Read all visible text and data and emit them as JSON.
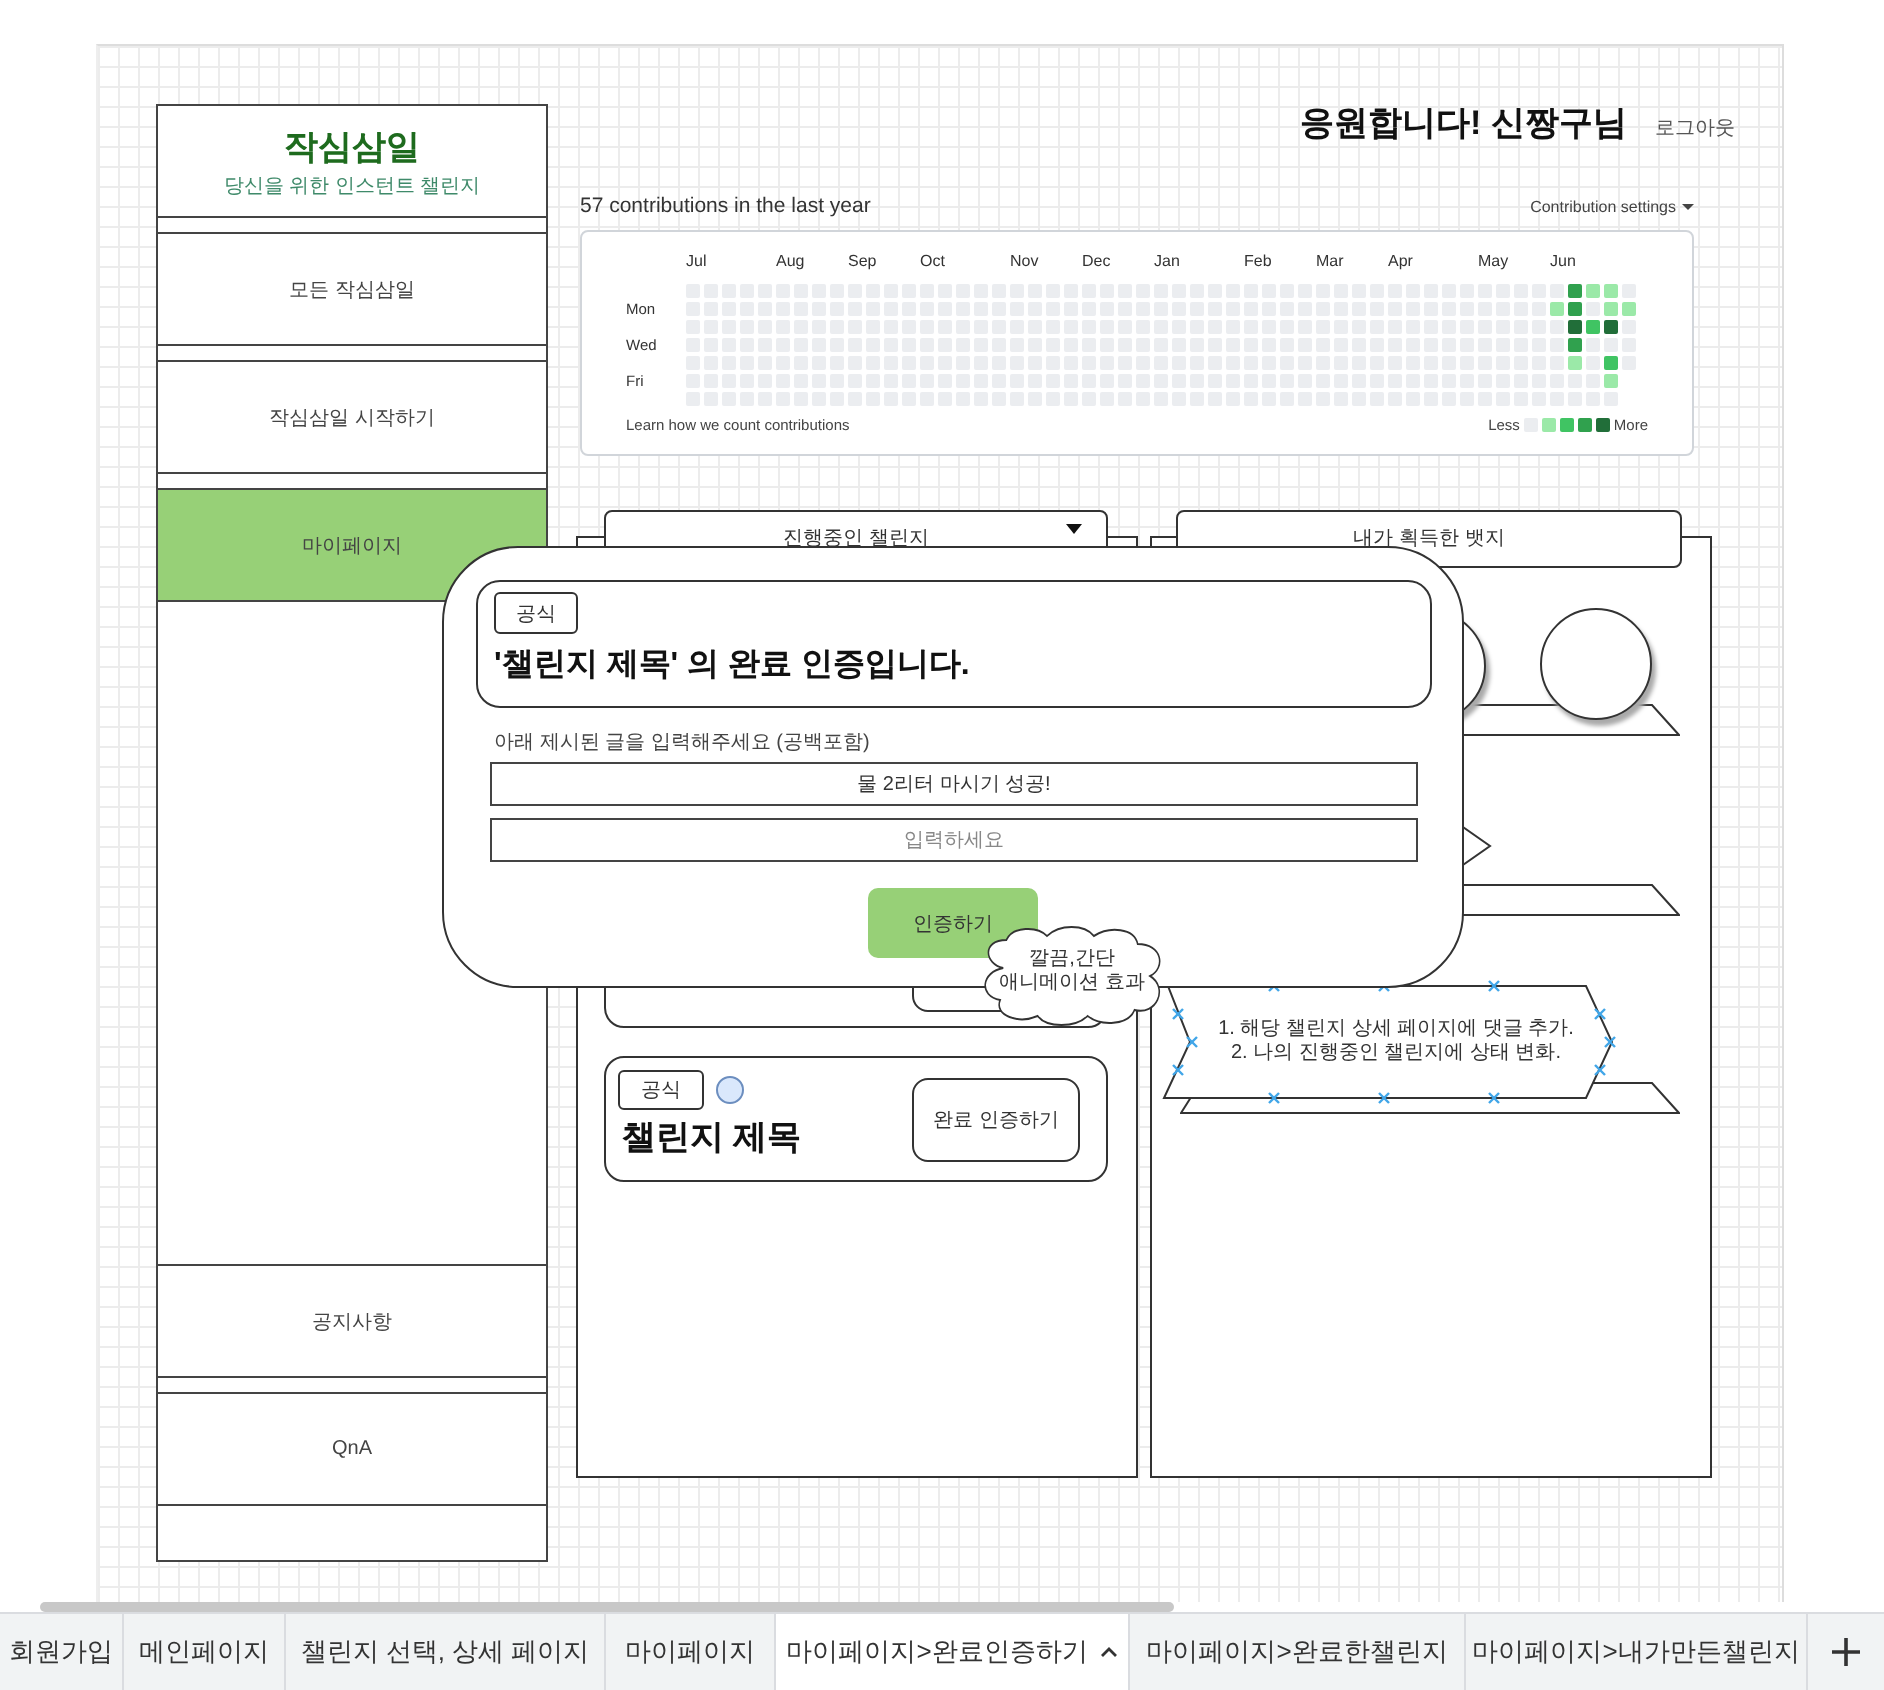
{
  "header": {
    "greeting": "응원합니다! 신짱구님",
    "logout": "로그아웃"
  },
  "sidebar": {
    "logo": "작심삼일",
    "tagline": "당신을 위한 인스턴트 챌린지",
    "items": [
      {
        "label": "모든 작심삼일",
        "selected": false
      },
      {
        "label": "작심삼일 시작하기",
        "selected": false
      },
      {
        "label": "마이페이지",
        "selected": true
      }
    ],
    "footer_items": [
      {
        "label": "공지사항",
        "selected": false
      },
      {
        "label": "QnA",
        "selected": false
      }
    ]
  },
  "contributions": {
    "title": "57 contributions in the last year",
    "settings": "Contribution settings",
    "months": [
      "Jul",
      "Aug",
      "Sep",
      "Oct",
      "Nov",
      "Dec",
      "Jan",
      "Feb",
      "Mar",
      "Apr",
      "May",
      "Jun"
    ],
    "rows": [
      {
        "day": "",
        "cells": [
          {
            "color": "#ebedf0"
          },
          {
            "color": "#ebedf0"
          },
          {
            "color": "#ebedf0"
          },
          {
            "color": "#ebedf0"
          },
          {
            "color": "#ebedf0"
          },
          {
            "color": "#ebedf0"
          },
          {
            "color": "#ebedf0"
          },
          {
            "color": "#ebedf0"
          },
          {
            "color": "#ebedf0"
          },
          {
            "color": "#ebedf0"
          },
          {
            "color": "#ebedf0"
          },
          {
            "color": "#ebedf0"
          },
          {
            "color": "#ebedf0"
          },
          {
            "color": "#ebedf0"
          },
          {
            "color": "#ebedf0"
          },
          {
            "color": "#ebedf0"
          },
          {
            "color": "#ebedf0"
          },
          {
            "color": "#ebedf0"
          },
          {
            "color": "#ebedf0"
          },
          {
            "color": "#ebedf0"
          },
          {
            "color": "#ebedf0"
          },
          {
            "color": "#ebedf0"
          },
          {
            "color": "#ebedf0"
          },
          {
            "color": "#ebedf0"
          },
          {
            "color": "#ebedf0"
          },
          {
            "color": "#ebedf0"
          },
          {
            "color": "#ebedf0"
          },
          {
            "color": "#ebedf0"
          },
          {
            "color": "#ebedf0"
          },
          {
            "color": "#ebedf0"
          },
          {
            "color": "#ebedf0"
          },
          {
            "color": "#ebedf0"
          },
          {
            "color": "#ebedf0"
          },
          {
            "color": "#ebedf0"
          },
          {
            "color": "#ebedf0"
          },
          {
            "color": "#ebedf0"
          },
          {
            "color": "#ebedf0"
          },
          {
            "color": "#ebedf0"
          },
          {
            "color": "#ebedf0"
          },
          {
            "color": "#ebedf0"
          },
          {
            "color": "#ebedf0"
          },
          {
            "color": "#ebedf0"
          },
          {
            "color": "#ebedf0"
          },
          {
            "color": "#ebedf0"
          },
          {
            "color": "#ebedf0"
          },
          {
            "color": "#ebedf0"
          },
          {
            "color": "#ebedf0"
          },
          {
            "color": "#ebedf0"
          },
          {
            "color": "#ebedf0"
          },
          {
            "color": "#30a14e"
          },
          {
            "color": "#9be9a8"
          },
          {
            "color": "#9be9a8"
          },
          {
            "color": "#ebedf0"
          }
        ]
      },
      {
        "day": "Mon",
        "cells": [
          {
            "color": "#ebedf0"
          },
          {
            "color": "#ebedf0"
          },
          {
            "color": "#ebedf0"
          },
          {
            "color": "#ebedf0"
          },
          {
            "color": "#ebedf0"
          },
          {
            "color": "#ebedf0"
          },
          {
            "color": "#ebedf0"
          },
          {
            "color": "#ebedf0"
          },
          {
            "color": "#ebedf0"
          },
          {
            "color": "#ebedf0"
          },
          {
            "color": "#ebedf0"
          },
          {
            "color": "#ebedf0"
          },
          {
            "color": "#ebedf0"
          },
          {
            "color": "#ebedf0"
          },
          {
            "color": "#ebedf0"
          },
          {
            "color": "#ebedf0"
          },
          {
            "color": "#ebedf0"
          },
          {
            "color": "#ebedf0"
          },
          {
            "color": "#ebedf0"
          },
          {
            "color": "#ebedf0"
          },
          {
            "color": "#ebedf0"
          },
          {
            "color": "#ebedf0"
          },
          {
            "color": "#ebedf0"
          },
          {
            "color": "#ebedf0"
          },
          {
            "color": "#ebedf0"
          },
          {
            "color": "#ebedf0"
          },
          {
            "color": "#ebedf0"
          },
          {
            "color": "#ebedf0"
          },
          {
            "color": "#ebedf0"
          },
          {
            "color": "#ebedf0"
          },
          {
            "color": "#ebedf0"
          },
          {
            "color": "#ebedf0"
          },
          {
            "color": "#ebedf0"
          },
          {
            "color": "#ebedf0"
          },
          {
            "color": "#ebedf0"
          },
          {
            "color": "#ebedf0"
          },
          {
            "color": "#ebedf0"
          },
          {
            "color": "#ebedf0"
          },
          {
            "color": "#ebedf0"
          },
          {
            "color": "#ebedf0"
          },
          {
            "color": "#ebedf0"
          },
          {
            "color": "#ebedf0"
          },
          {
            "color": "#ebedf0"
          },
          {
            "color": "#ebedf0"
          },
          {
            "color": "#ebedf0"
          },
          {
            "color": "#ebedf0"
          },
          {
            "color": "#ebedf0"
          },
          {
            "color": "#ebedf0"
          },
          {
            "color": "#9be9a8"
          },
          {
            "color": "#30a14e"
          },
          {
            "color": "#ebedf0"
          },
          {
            "color": "#9be9a8"
          },
          {
            "color": "#9be9a8"
          }
        ]
      },
      {
        "day": "",
        "cells": [
          {
            "color": "#ebedf0"
          },
          {
            "color": "#ebedf0"
          },
          {
            "color": "#ebedf0"
          },
          {
            "color": "#ebedf0"
          },
          {
            "color": "#ebedf0"
          },
          {
            "color": "#ebedf0"
          },
          {
            "color": "#ebedf0"
          },
          {
            "color": "#ebedf0"
          },
          {
            "color": "#ebedf0"
          },
          {
            "color": "#ebedf0"
          },
          {
            "color": "#ebedf0"
          },
          {
            "color": "#ebedf0"
          },
          {
            "color": "#ebedf0"
          },
          {
            "color": "#ebedf0"
          },
          {
            "color": "#ebedf0"
          },
          {
            "color": "#ebedf0"
          },
          {
            "color": "#ebedf0"
          },
          {
            "color": "#ebedf0"
          },
          {
            "color": "#ebedf0"
          },
          {
            "color": "#ebedf0"
          },
          {
            "color": "#ebedf0"
          },
          {
            "color": "#ebedf0"
          },
          {
            "color": "#ebedf0"
          },
          {
            "color": "#ebedf0"
          },
          {
            "color": "#ebedf0"
          },
          {
            "color": "#ebedf0"
          },
          {
            "color": "#ebedf0"
          },
          {
            "color": "#ebedf0"
          },
          {
            "color": "#ebedf0"
          },
          {
            "color": "#ebedf0"
          },
          {
            "color": "#ebedf0"
          },
          {
            "color": "#ebedf0"
          },
          {
            "color": "#ebedf0"
          },
          {
            "color": "#ebedf0"
          },
          {
            "color": "#ebedf0"
          },
          {
            "color": "#ebedf0"
          },
          {
            "color": "#ebedf0"
          },
          {
            "color": "#ebedf0"
          },
          {
            "color": "#ebedf0"
          },
          {
            "color": "#ebedf0"
          },
          {
            "color": "#ebedf0"
          },
          {
            "color": "#ebedf0"
          },
          {
            "color": "#ebedf0"
          },
          {
            "color": "#ebedf0"
          },
          {
            "color": "#ebedf0"
          },
          {
            "color": "#ebedf0"
          },
          {
            "color": "#ebedf0"
          },
          {
            "color": "#ebedf0"
          },
          {
            "color": "#ebedf0"
          },
          {
            "color": "#216e39"
          },
          {
            "color": "#40c463"
          },
          {
            "color": "#216e39"
          },
          {
            "color": "#ebedf0"
          }
        ]
      },
      {
        "day": "Wed",
        "cells": [
          {
            "color": "#ebedf0"
          },
          {
            "color": "#ebedf0"
          },
          {
            "color": "#ebedf0"
          },
          {
            "color": "#ebedf0"
          },
          {
            "color": "#ebedf0"
          },
          {
            "color": "#ebedf0"
          },
          {
            "color": "#ebedf0"
          },
          {
            "color": "#ebedf0"
          },
          {
            "color": "#ebedf0"
          },
          {
            "color": "#ebedf0"
          },
          {
            "color": "#ebedf0"
          },
          {
            "color": "#ebedf0"
          },
          {
            "color": "#ebedf0"
          },
          {
            "color": "#ebedf0"
          },
          {
            "color": "#ebedf0"
          },
          {
            "color": "#ebedf0"
          },
          {
            "color": "#ebedf0"
          },
          {
            "color": "#ebedf0"
          },
          {
            "color": "#ebedf0"
          },
          {
            "color": "#ebedf0"
          },
          {
            "color": "#ebedf0"
          },
          {
            "color": "#ebedf0"
          },
          {
            "color": "#ebedf0"
          },
          {
            "color": "#ebedf0"
          },
          {
            "color": "#ebedf0"
          },
          {
            "color": "#ebedf0"
          },
          {
            "color": "#ebedf0"
          },
          {
            "color": "#ebedf0"
          },
          {
            "color": "#ebedf0"
          },
          {
            "color": "#ebedf0"
          },
          {
            "color": "#ebedf0"
          },
          {
            "color": "#ebedf0"
          },
          {
            "color": "#ebedf0"
          },
          {
            "color": "#ebedf0"
          },
          {
            "color": "#ebedf0"
          },
          {
            "color": "#ebedf0"
          },
          {
            "color": "#ebedf0"
          },
          {
            "color": "#ebedf0"
          },
          {
            "color": "#ebedf0"
          },
          {
            "color": "#ebedf0"
          },
          {
            "color": "#ebedf0"
          },
          {
            "color": "#ebedf0"
          },
          {
            "color": "#ebedf0"
          },
          {
            "color": "#ebedf0"
          },
          {
            "color": "#ebedf0"
          },
          {
            "color": "#ebedf0"
          },
          {
            "color": "#ebedf0"
          },
          {
            "color": "#ebedf0"
          },
          {
            "color": "#ebedf0"
          },
          {
            "color": "#30a14e"
          },
          {
            "color": "#ebedf0"
          },
          {
            "color": "#ebedf0"
          },
          {
            "color": "#ebedf0"
          }
        ]
      },
      {
        "day": "",
        "cells": [
          {
            "color": "#ebedf0"
          },
          {
            "color": "#ebedf0"
          },
          {
            "color": "#ebedf0"
          },
          {
            "color": "#ebedf0"
          },
          {
            "color": "#ebedf0"
          },
          {
            "color": "#ebedf0"
          },
          {
            "color": "#ebedf0"
          },
          {
            "color": "#ebedf0"
          },
          {
            "color": "#ebedf0"
          },
          {
            "color": "#ebedf0"
          },
          {
            "color": "#ebedf0"
          },
          {
            "color": "#ebedf0"
          },
          {
            "color": "#ebedf0"
          },
          {
            "color": "#ebedf0"
          },
          {
            "color": "#ebedf0"
          },
          {
            "color": "#ebedf0"
          },
          {
            "color": "#ebedf0"
          },
          {
            "color": "#ebedf0"
          },
          {
            "color": "#ebedf0"
          },
          {
            "color": "#ebedf0"
          },
          {
            "color": "#ebedf0"
          },
          {
            "color": "#ebedf0"
          },
          {
            "color": "#ebedf0"
          },
          {
            "color": "#ebedf0"
          },
          {
            "color": "#ebedf0"
          },
          {
            "color": "#ebedf0"
          },
          {
            "color": "#ebedf0"
          },
          {
            "color": "#ebedf0"
          },
          {
            "color": "#ebedf0"
          },
          {
            "color": "#ebedf0"
          },
          {
            "color": "#ebedf0"
          },
          {
            "color": "#ebedf0"
          },
          {
            "color": "#ebedf0"
          },
          {
            "color": "#ebedf0"
          },
          {
            "color": "#ebedf0"
          },
          {
            "color": "#ebedf0"
          },
          {
            "color": "#ebedf0"
          },
          {
            "color": "#ebedf0"
          },
          {
            "color": "#ebedf0"
          },
          {
            "color": "#ebedf0"
          },
          {
            "color": "#ebedf0"
          },
          {
            "color": "#ebedf0"
          },
          {
            "color": "#ebedf0"
          },
          {
            "color": "#ebedf0"
          },
          {
            "color": "#ebedf0"
          },
          {
            "color": "#ebedf0"
          },
          {
            "color": "#ebedf0"
          },
          {
            "color": "#ebedf0"
          },
          {
            "color": "#ebedf0"
          },
          {
            "color": "#9be9a8"
          },
          {
            "color": "#ebedf0"
          },
          {
            "color": "#40c463"
          },
          {
            "color": "#ebedf0"
          }
        ]
      },
      {
        "day": "Fri",
        "cells": [
          {
            "color": "#ebedf0"
          },
          {
            "color": "#ebedf0"
          },
          {
            "color": "#ebedf0"
          },
          {
            "color": "#ebedf0"
          },
          {
            "color": "#ebedf0"
          },
          {
            "color": "#ebedf0"
          },
          {
            "color": "#ebedf0"
          },
          {
            "color": "#ebedf0"
          },
          {
            "color": "#ebedf0"
          },
          {
            "color": "#ebedf0"
          },
          {
            "color": "#ebedf0"
          },
          {
            "color": "#ebedf0"
          },
          {
            "color": "#ebedf0"
          },
          {
            "color": "#ebedf0"
          },
          {
            "color": "#ebedf0"
          },
          {
            "color": "#ebedf0"
          },
          {
            "color": "#ebedf0"
          },
          {
            "color": "#ebedf0"
          },
          {
            "color": "#ebedf0"
          },
          {
            "color": "#ebedf0"
          },
          {
            "color": "#ebedf0"
          },
          {
            "color": "#ebedf0"
          },
          {
            "color": "#ebedf0"
          },
          {
            "color": "#ebedf0"
          },
          {
            "color": "#ebedf0"
          },
          {
            "color": "#ebedf0"
          },
          {
            "color": "#ebedf0"
          },
          {
            "color": "#ebedf0"
          },
          {
            "color": "#ebedf0"
          },
          {
            "color": "#ebedf0"
          },
          {
            "color": "#ebedf0"
          },
          {
            "color": "#ebedf0"
          },
          {
            "color": "#ebedf0"
          },
          {
            "color": "#ebedf0"
          },
          {
            "color": "#ebedf0"
          },
          {
            "color": "#ebedf0"
          },
          {
            "color": "#ebedf0"
          },
          {
            "color": "#ebedf0"
          },
          {
            "color": "#ebedf0"
          },
          {
            "color": "#ebedf0"
          },
          {
            "color": "#ebedf0"
          },
          {
            "color": "#ebedf0"
          },
          {
            "color": "#ebedf0"
          },
          {
            "color": "#ebedf0"
          },
          {
            "color": "#ebedf0"
          },
          {
            "color": "#ebedf0"
          },
          {
            "color": "#ebedf0"
          },
          {
            "color": "#ebedf0"
          },
          {
            "color": "#ebedf0"
          },
          {
            "color": "#ebedf0"
          },
          {
            "color": "#ebedf0"
          },
          {
            "color": "#9be9a8"
          }
        ]
      },
      {
        "day": "",
        "cells": [
          {
            "color": "#ebedf0"
          },
          {
            "color": "#ebedf0"
          },
          {
            "color": "#ebedf0"
          },
          {
            "color": "#ebedf0"
          },
          {
            "color": "#ebedf0"
          },
          {
            "color": "#ebedf0"
          },
          {
            "color": "#ebedf0"
          },
          {
            "color": "#ebedf0"
          },
          {
            "color": "#ebedf0"
          },
          {
            "color": "#ebedf0"
          },
          {
            "color": "#ebedf0"
          },
          {
            "color": "#ebedf0"
          },
          {
            "color": "#ebedf0"
          },
          {
            "color": "#ebedf0"
          },
          {
            "color": "#ebedf0"
          },
          {
            "color": "#ebedf0"
          },
          {
            "color": "#ebedf0"
          },
          {
            "color": "#ebedf0"
          },
          {
            "color": "#ebedf0"
          },
          {
            "color": "#ebedf0"
          },
          {
            "color": "#ebedf0"
          },
          {
            "color": "#ebedf0"
          },
          {
            "color": "#ebedf0"
          },
          {
            "color": "#ebedf0"
          },
          {
            "color": "#ebedf0"
          },
          {
            "color": "#ebedf0"
          },
          {
            "color": "#ebedf0"
          },
          {
            "color": "#ebedf0"
          },
          {
            "color": "#ebedf0"
          },
          {
            "color": "#ebedf0"
          },
          {
            "color": "#ebedf0"
          },
          {
            "color": "#ebedf0"
          },
          {
            "color": "#ebedf0"
          },
          {
            "color": "#ebedf0"
          },
          {
            "color": "#ebedf0"
          },
          {
            "color": "#ebedf0"
          },
          {
            "color": "#ebedf0"
          },
          {
            "color": "#ebedf0"
          },
          {
            "color": "#ebedf0"
          },
          {
            "color": "#ebedf0"
          },
          {
            "color": "#ebedf0"
          },
          {
            "color": "#ebedf0"
          },
          {
            "color": "#ebedf0"
          },
          {
            "color": "#ebedf0"
          },
          {
            "color": "#ebedf0"
          },
          {
            "color": "#ebedf0"
          },
          {
            "color": "#ebedf0"
          },
          {
            "color": "#ebedf0"
          },
          {
            "color": "#ebedf0"
          },
          {
            "color": "#ebedf0"
          },
          {
            "color": "#ebedf0"
          },
          {
            "color": "#ebedf0"
          }
        ]
      }
    ],
    "learn_link": "Learn how we count contributions",
    "legend_less": "Less",
    "legend_more": "More"
  },
  "challenges": {
    "dropdown": "진행중인 챌린지",
    "cards": [
      {
        "kind": "covered"
      },
      {
        "kind": "full",
        "tag": "공식",
        "title": "챌린지 제목",
        "button": "완료 인증하기"
      }
    ]
  },
  "badges": {
    "header": "내가 획득한 뱃지"
  },
  "note": {
    "lines": [
      "1. 해당 챌린지 상세 페이지에 댓글 추가.",
      "2. 나의 진행중인 챌린지에 상태 변화."
    ]
  },
  "cloud": {
    "lines": [
      "깔끔,간단",
      "애니메이션 효과"
    ]
  },
  "modal": {
    "tag": "공식",
    "heading": "'챌린지 제목' 의 완료 인증입니다.",
    "instruction": "아래 제시된 글을 입력해주세요 (공백포함)",
    "given_text": "물 2리터 마시기 성공!",
    "placeholder": "입력하세요",
    "button": "인증하기"
  },
  "tabs": [
    {
      "label": "회원가입",
      "selected": false
    },
    {
      "label": "메인페이지",
      "selected": false
    },
    {
      "label": "챌린지 선택, 상세 페이지",
      "selected": false
    },
    {
      "label": "마이페이지",
      "selected": false
    },
    {
      "label": "마이페이지>완료인증하기",
      "selected": true
    },
    {
      "label": "마이페이지>완료한챌린지",
      "selected": false
    },
    {
      "label": "마이페이지>내가만든챌린지",
      "selected": false
    }
  ]
}
